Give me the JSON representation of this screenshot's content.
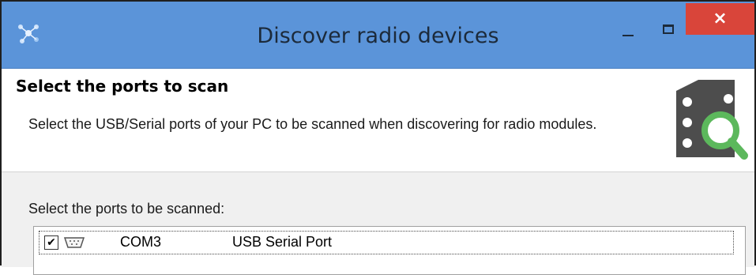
{
  "window": {
    "title": "Discover radio devices",
    "close_glyph": "×",
    "accent_color": "#5b94d9",
    "close_color": "#d9453a"
  },
  "header": {
    "title": "Select the ports to scan",
    "description": "Select the USB/Serial ports of your PC to be scanned when discovering for radio modules.",
    "icon": "radio-module-search-icon"
  },
  "ports": {
    "label": "Select the ports to be scanned:",
    "items": [
      {
        "checked": true,
        "check_glyph": "✔",
        "icon": "serial-port-icon",
        "name": "COM3",
        "description": "USB Serial Port"
      }
    ]
  }
}
